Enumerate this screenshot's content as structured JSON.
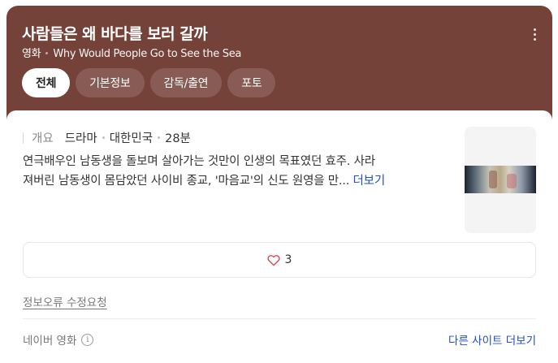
{
  "movie": {
    "title": "사람들은 왜 바다를 보러 갈까",
    "category": "영화",
    "english_title": "Why Would People Go to See the Sea"
  },
  "tabs": [
    {
      "label": "전체",
      "active": true
    },
    {
      "label": "기본정보",
      "active": false
    },
    {
      "label": "감독/출연",
      "active": false
    },
    {
      "label": "포토",
      "active": false
    }
  ],
  "overview": {
    "label": "개요",
    "genre": "드라마",
    "country": "대한민국",
    "runtime": "28분",
    "synopsis_line1": "연극배우인 남동생을 돌보며 살아가는 것만이 인생의 목표였던 효주. 사라",
    "synopsis_line2": "져버린 남동생이 몸담았던 사이비 종교, '마음교'의 신도 원영을 만...",
    "more_label": "더보기"
  },
  "like": {
    "count": "3",
    "icon": "heart-outline-icon"
  },
  "report_label": "정보오류 수정요청",
  "footer": {
    "source": "네이버 영화",
    "other_sites": "다른 사이트 더보기"
  },
  "colors": {
    "header_bg": "#754239",
    "link": "#1f4fbd",
    "heart": "#e0435a"
  }
}
